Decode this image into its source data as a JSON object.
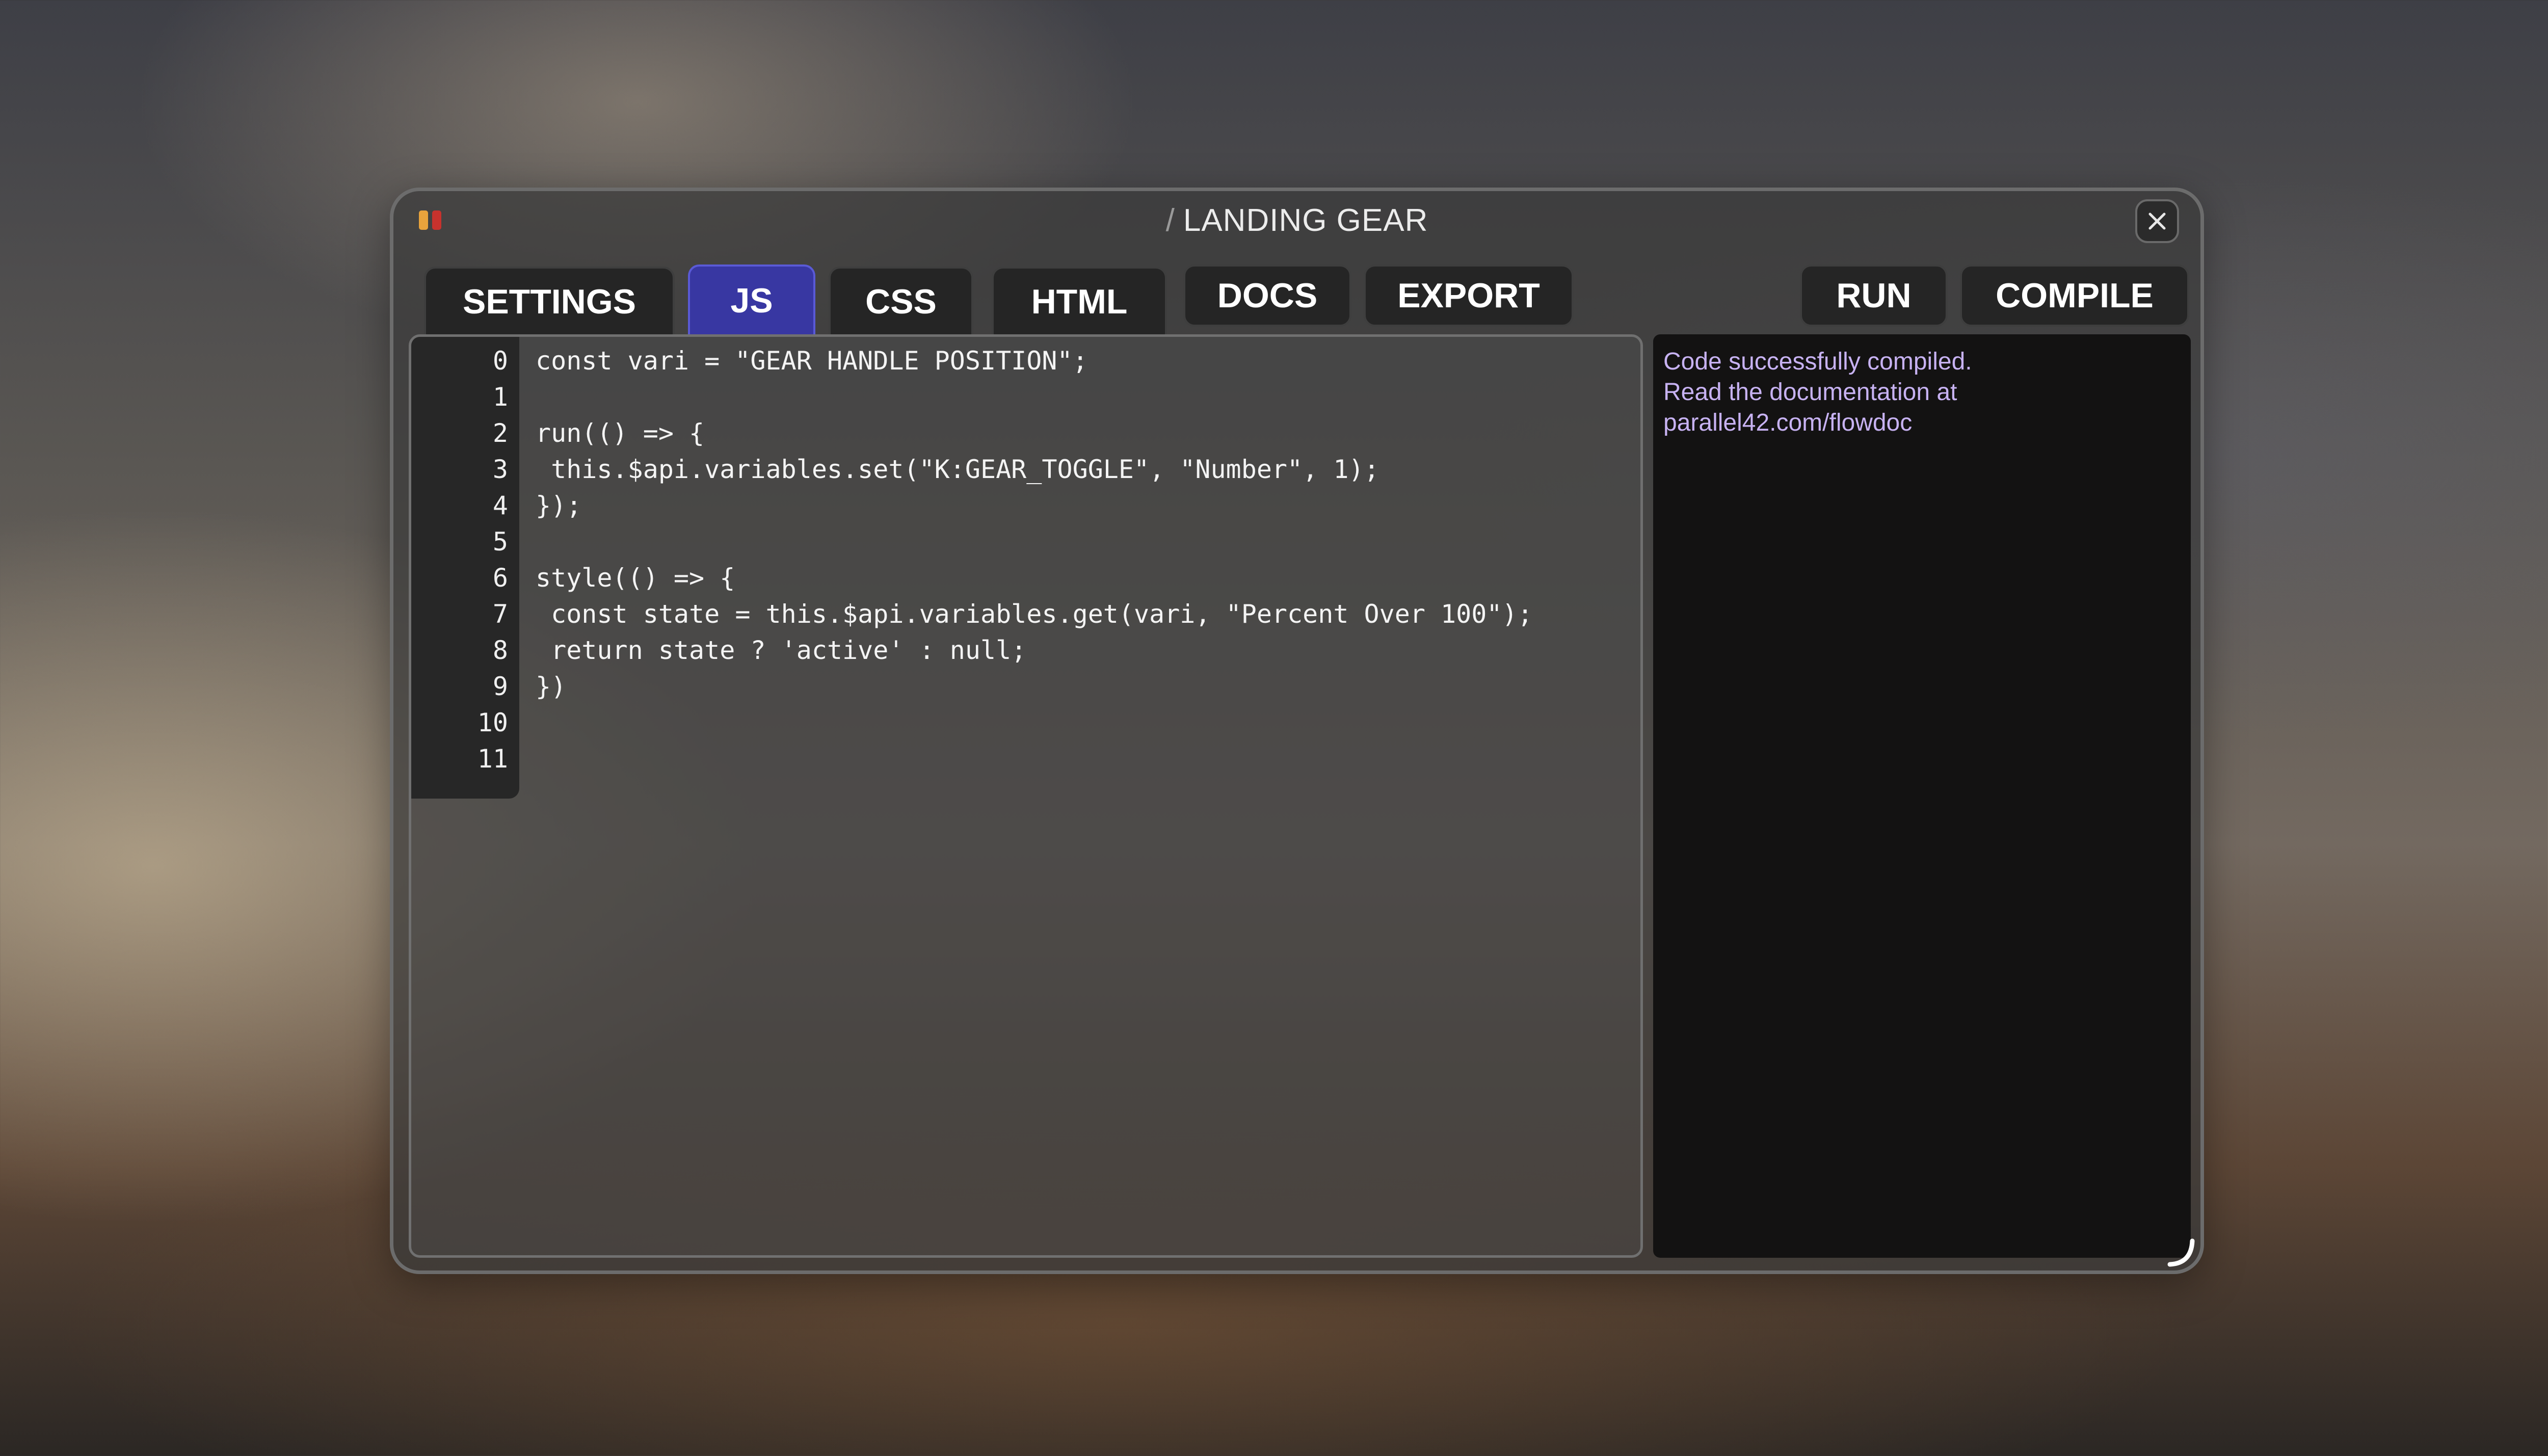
{
  "window": {
    "breadcrumb_separator": "/",
    "title": "LANDING GEAR",
    "logo_icon": "bars-logo",
    "logo_colors": [
      "#e8a33c",
      "#c8322d"
    ]
  },
  "tabs": [
    {
      "label": "SETTINGS",
      "active": false
    },
    {
      "label": "JS",
      "active": true
    },
    {
      "label": "CSS",
      "active": false
    },
    {
      "label": "HTML",
      "active": false
    }
  ],
  "toolbar": {
    "docs_label": "DOCS",
    "export_label": "EXPORT",
    "run_label": "RUN",
    "compile_label": "COMPILE"
  },
  "editor": {
    "lines": [
      {
        "n": "0",
        "code": "const vari = \"GEAR HANDLE POSITION\";"
      },
      {
        "n": "1",
        "code": ""
      },
      {
        "n": "2",
        "code": "run(() => {"
      },
      {
        "n": "3",
        "code": " this.$api.variables.set(\"K:GEAR_TOGGLE\", \"Number\", 1);"
      },
      {
        "n": "4",
        "code": "});"
      },
      {
        "n": "5",
        "code": ""
      },
      {
        "n": "6",
        "code": "style(() => {"
      },
      {
        "n": "7",
        "code": " const state = this.$api.variables.get(vari, \"Percent Over 100\");"
      },
      {
        "n": "8",
        "code": " return state ? 'active' : null;"
      },
      {
        "n": "9",
        "code": "})"
      },
      {
        "n": "10",
        "code": ""
      },
      {
        "n": "11",
        "code": ""
      }
    ]
  },
  "console": {
    "lines": [
      "Code successfully compiled.",
      "Read the documentation at",
      "parallel42.com/flowdoc"
    ],
    "text_color": "#c7b2f2"
  },
  "colors": {
    "active_tab": "#3837a2",
    "button_bg": "#252525",
    "console_bg": "#131212"
  }
}
